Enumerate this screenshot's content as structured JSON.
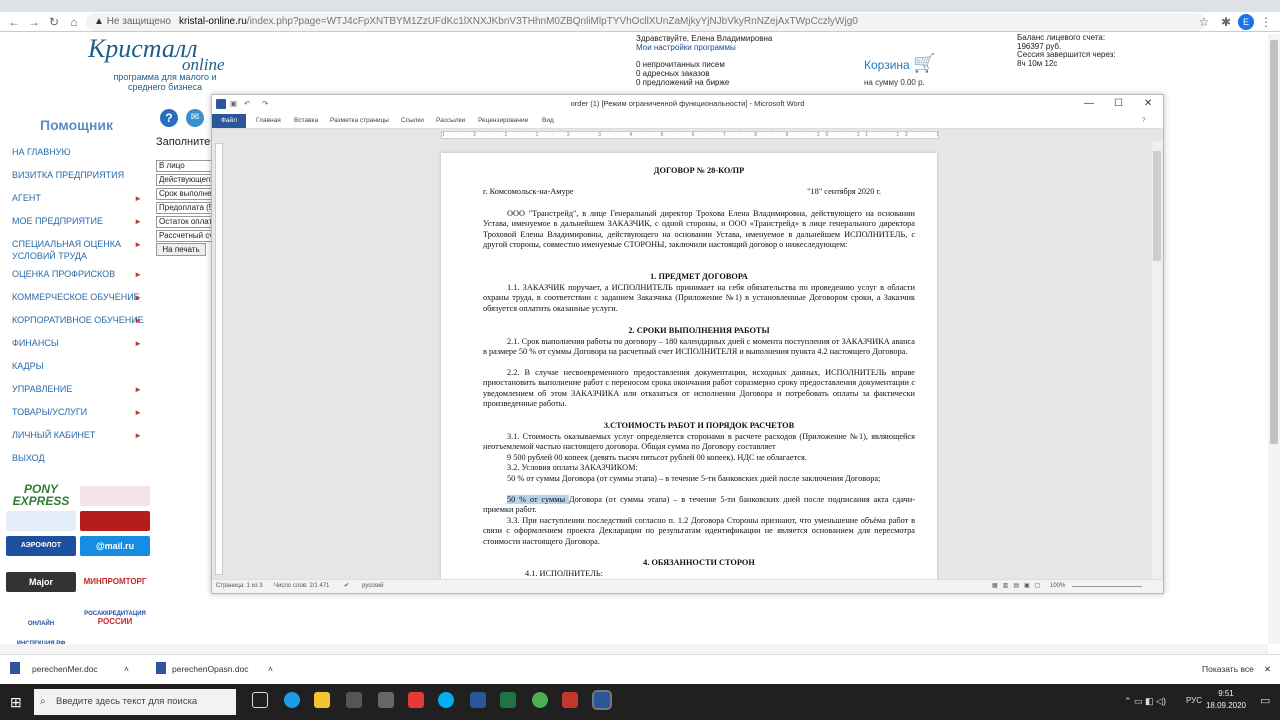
{
  "browser": {
    "not_secure": "Не защищено",
    "domain": "kristal-online.ru",
    "url_rest": "/index.php?page=WTJ4cFpXNTBYM1ZzUFdKc1lXNXJKbnV3THhnM0ZBQnliMlpTYVhOcllXUnZaMjkyYjNJbVkyRnNZejAxTWpCczlyWjg0",
    "profile": "Е"
  },
  "site": {
    "logo_main": "Кристалл",
    "logo_online": "online",
    "logo_sub": "программа для малого и среднего бизнеса",
    "greeting": "Здравствуйте, Елена Владимировна",
    "settings_link": "Мои настройки программы",
    "unread": "0 непрочитанных писем",
    "addr_orders": "0 адресных заказов",
    "offers": "0 предложений на бирже",
    "cart_label": "Корзина",
    "cart_sum": "на сумму 0.00 р.",
    "balance_label": "Баланс лицевого счета:",
    "balance_value": "196397 руб.",
    "session_label": "Сессия завершится через:",
    "session_value": "8ч 10м 12с",
    "helper_title": "Помощник",
    "fill_label": "Заполните",
    "menu": [
      "НА ГЛАВНУЮ",
      "ВИЗИТКА ПРЕДПРИЯТИЯ",
      "АГЕНТ",
      "МОЕ ПРЕДПРИЯТИЕ",
      "СПЕЦИАЛЬНАЯ ОЦЕНКА УСЛОВИЙ ТРУДА",
      "ОЦЕНКА ПРОФРИСКОВ",
      "КОММЕРЧЕСКОЕ ОБУЧЕНИЕ",
      "КОРПОРАТИВНОЕ ОБУЧЕНИЕ",
      "ФИНАНСЫ",
      "КАДРЫ",
      "УПРАВЛЕНИЕ",
      "ТОВАРЫ/УСЛУГИ",
      "ЛИЧНЫЙ КАБИНЕТ",
      "ВЫХОД"
    ],
    "side_fields": [
      "В лицо",
      "Действующего",
      "Срок выполне",
      "Предоплата (5",
      "Остаток оплат",
      "Рассчетный сч"
    ],
    "print_btn": "На печать",
    "partners": [
      "PONY EXPRESS",
      "АЭРОФЛОТ",
      "@mail.ru",
      "Major",
      "МИНПРОМТОРГ РОССИИ",
      "ОНЛАЙН ИНСПЕКЦИЯ.РФ",
      "РОСАККРЕДИТАЦИЯ"
    ]
  },
  "word": {
    "title": "order (1) [Режим ограниченной функциональности] - Microsoft Word",
    "tabs": [
      "Файл",
      "Главная",
      "Вставка",
      "Разметка страницы",
      "Ссылки",
      "Рассылки",
      "Рецензирование",
      "Вид"
    ],
    "ruler": "1 · 2 · 1 · 1 · 2 · 3 · 4 · 5 · 6 · 7 · 8 · 9 · 10 · 11 · 12 · 13 · 14 · 15 · 16 · 17 · 18",
    "status_page": "Страница: 1 из 3",
    "status_words": "Число слов: 2/1 471",
    "status_lang": "русский",
    "zoom": "100%",
    "doc": {
      "title": "ДОГОВОР № 28-КО/ПР",
      "city": "г. Комсомольск-на-Амуре",
      "date": "\"18\" сентября 2020 г.",
      "p1": "ООО \"Транстрейд\", в лице Генеральный директор Трохова Елена Владимировна, действующего на основании Устава, именуемое в дальнейшем ЗАКАЗЧИК, с одной стороны, и ООО «Транстрейд» в лице генерального директора Троховой Елены Владимировны, действующего на основании Устава, именуемое в дальнейшем ИСПОЛНИТЕЛЬ, с другой стороны, совместно именуемые СТОРОНЫ, заключили настоящий договор о нижеследующем:",
      "h1": "1. ПРЕДМЕТ ДОГОВОРА",
      "p2": "1.1. ЗАКАЗЧИК поручает, а ИСПОЛНИТЕЛЬ принимает на себя обязательства по проведению услуг в области охраны труда, в соответствии с заданием Заказчика (Приложение №1) в установленные Договором сроки, а Заказчик обязуется оплатить оказанные услуги.",
      "h2": "2. СРОКИ ВЫПОЛНЕНИЯ РАБОТЫ",
      "p3": "2.1. Срок выполнения работы по договору – 180 календарных дней с момента поступления от ЗАКАЗЧИКА аванса в размере 50 % от суммы Договора на расчетный счет ИСПОЛНИТЕЛЯ и выполнения пункта 4.2 настоящего Договора.",
      "p4": "2.2. В случае несвоевременного предоставления документации, исходных данных, ИСПОЛНИТЕЛЬ вправе приостановить выполнение работ с переносом срока окончания работ соразмерно сроку предоставления документации с уведомлением об этом ЗАКАЗЧИКА или отказаться от исполнения Договора и потребовать оплаты за фактически произведенные работы.",
      "h3": "3.СТОИМОСТЬ РАБОТ И ПОРЯДОК РАСЧЕТОВ",
      "p5": "3.1. Стоимость оказываемых услуг определяется сторонами в расчете расходов (Приложение №1), являющейся неотъемлемой частью настоящего договора. Общая сумма по Договору составляет",
      "p6": "9 500 рублей 00 копеек (девять тысяч пятьсот рублей 00 копеек). НДС не облагается.",
      "p7": "3.2. Условия оплаты ЗАКАЗЧИКОМ:",
      "p8": "50 % от суммы Договора (от суммы этапа) – в течение 5-ти банковских дней после заключения Договора;",
      "p9a": "50 % от суммы ",
      "p9b": "Договора (от суммы этапа) – в течение 5-ти банковских дней после подписания акта сдачи-приемки работ.",
      "p10": "3.3. При наступлении последствий согласно п. 1.2 Договора Стороны признают, что уменьшение объёма работ в связи с оформлением проекта Декларации по результатам идентификации не является основанием для пересмотра стоимости настоящего Договора.",
      "h4": "4. ОБЯЗАННОСТИ СТОРОН",
      "p11": "4.1. ИСПОЛНИТЕЛЬ:"
    }
  },
  "downloads": {
    "file1": "perechenMer.doc",
    "file2": "perechenOpasn.doc",
    "show_all": "Показать все"
  },
  "taskbar": {
    "search_placeholder": "Введите здесь текст для поиска",
    "lang": "РУС",
    "time": "9:51",
    "date": "18.09.2020"
  }
}
